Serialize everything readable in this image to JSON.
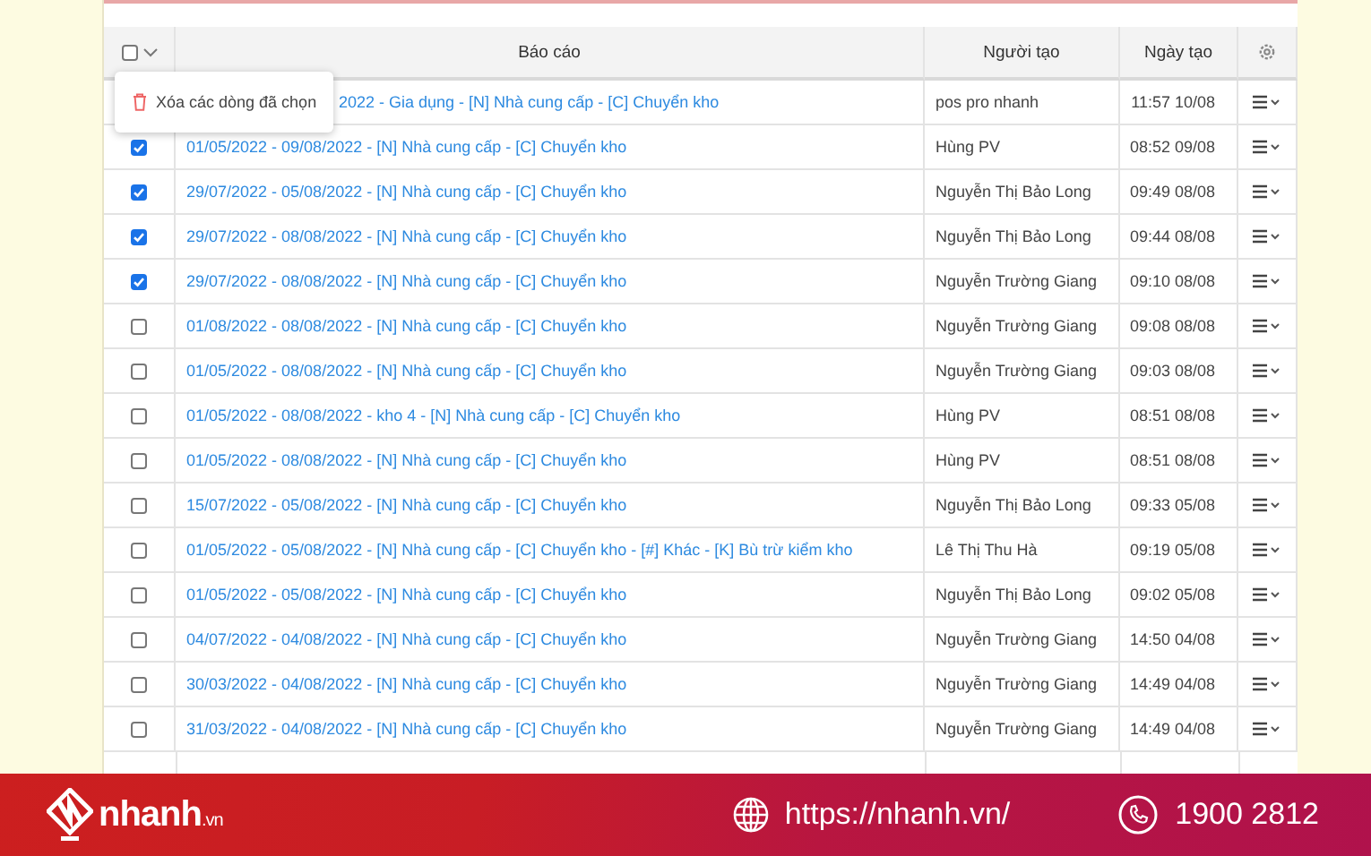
{
  "table": {
    "columns": [
      {
        "kind": "select"
      },
      {
        "kind": "text",
        "label": "Báo cáo"
      },
      {
        "kind": "text",
        "label": "Người tạo"
      },
      {
        "kind": "text",
        "label": "Ngày tạo"
      },
      {
        "kind": "settings"
      }
    ],
    "select_all": {
      "checked": false
    },
    "rows": [
      {
        "kind": "covered",
        "report": "2022 - Gia dụng - [N] Nhà cung cấp - [C] Chuyển kho",
        "creator": "pos pro nhanh",
        "date": "11:57 10/08"
      },
      {
        "kind": "row",
        "checked": true,
        "report": "01/05/2022 - 09/08/2022 - [N] Nhà cung cấp - [C] Chuyển kho",
        "creator": "Hùng PV",
        "date": "08:52 09/08"
      },
      {
        "kind": "row",
        "checked": true,
        "report": "29/07/2022 - 05/08/2022 - [N] Nhà cung cấp - [C] Chuyển kho",
        "creator": "Nguyễn Thị Bảo Long",
        "date": "09:49 08/08"
      },
      {
        "kind": "row",
        "checked": true,
        "report": "29/07/2022 - 08/08/2022 - [N] Nhà cung cấp - [C] Chuyển kho",
        "creator": "Nguyễn Thị Bảo Long",
        "date": "09:44 08/08"
      },
      {
        "kind": "row",
        "checked": true,
        "report": "29/07/2022 - 08/08/2022 - [N] Nhà cung cấp - [C] Chuyển kho",
        "creator": "Nguyễn Trường Giang",
        "date": "09:10 08/08"
      },
      {
        "kind": "row",
        "checked": false,
        "report": "01/08/2022 - 08/08/2022 - [N] Nhà cung cấp - [C] Chuyển kho",
        "creator": "Nguyễn Trường Giang",
        "date": "09:08 08/08"
      },
      {
        "kind": "row",
        "checked": false,
        "report": "01/05/2022 - 08/08/2022 - [N] Nhà cung cấp - [C] Chuyển kho",
        "creator": "Nguyễn Trường Giang",
        "date": "09:03 08/08"
      },
      {
        "kind": "row",
        "checked": false,
        "report": "01/05/2022 - 08/08/2022 - kho 4 - [N] Nhà cung cấp - [C] Chuyển kho",
        "creator": "Hùng PV",
        "date": "08:51 08/08"
      },
      {
        "kind": "row",
        "checked": false,
        "report": "01/05/2022 - 08/08/2022 - [N] Nhà cung cấp - [C] Chuyển kho",
        "creator": "Hùng PV",
        "date": "08:51 08/08"
      },
      {
        "kind": "row",
        "checked": false,
        "report": "15/07/2022 - 05/08/2022 - [N] Nhà cung cấp - [C] Chuyển kho",
        "creator": "Nguyễn Thị Bảo Long",
        "date": "09:33 05/08"
      },
      {
        "kind": "row",
        "checked": false,
        "report": "01/05/2022 - 05/08/2022 - [N] Nhà cung cấp - [C] Chuyển kho - [#] Khác - [K] Bù trừ kiểm kho",
        "creator": "Lê Thị Thu Hà",
        "date": "09:19 05/08"
      },
      {
        "kind": "row",
        "checked": false,
        "report": "01/05/2022 - 05/08/2022 - [N] Nhà cung cấp - [C] Chuyển kho",
        "creator": "Nguyễn Thị Bảo Long",
        "date": "09:02 05/08"
      },
      {
        "kind": "row",
        "checked": false,
        "report": "04/07/2022 - 04/08/2022 - [N] Nhà cung cấp - [C] Chuyển kho",
        "creator": "Nguyễn Trường Giang",
        "date": "14:50 04/08"
      },
      {
        "kind": "row",
        "checked": false,
        "report": "30/03/2022 - 04/08/2022 - [N] Nhà cung cấp - [C] Chuyển kho",
        "creator": "Nguyễn Trường Giang",
        "date": "14:49 04/08"
      },
      {
        "kind": "row",
        "checked": false,
        "report": "31/03/2022 - 04/08/2022 - [N] Nhà cung cấp - [C] Chuyển kho",
        "creator": "Nguyễn Trường Giang",
        "date": "14:49 04/08"
      }
    ]
  },
  "bulk_menu": {
    "items": [
      "Xóa các dòng đã chọn"
    ]
  },
  "banner": {
    "brand": "nhanh",
    "brand_suffix": ".vn",
    "website": "https://nhanh.vn/",
    "phone": "1900 2812"
  }
}
